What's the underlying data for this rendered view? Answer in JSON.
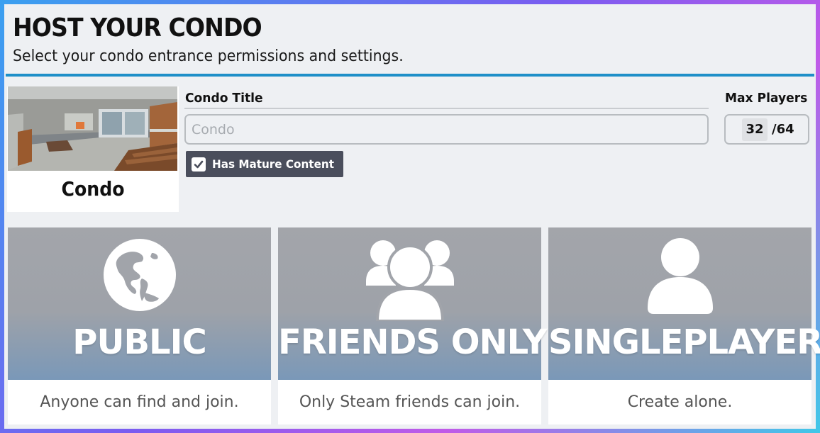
{
  "header": {
    "title": "HOST YOUR CONDO",
    "subtitle": "Select your condo entrance permissions and settings."
  },
  "condo": {
    "name": "Condo"
  },
  "form": {
    "title_label": "Condo Title",
    "title_placeholder": "Condo",
    "title_value": "",
    "mature_label": "Has Mature Content",
    "mature_checked": true,
    "max_players_label": "Max Players",
    "max_players_value": "32",
    "max_players_total": "/64"
  },
  "modes": [
    {
      "title": "PUBLIC",
      "description": "Anyone can find and join.",
      "icon": "globe-icon"
    },
    {
      "title": "FRIENDS ONLY",
      "description": "Only Steam friends can join.",
      "icon": "friends-icon"
    },
    {
      "title": "SINGLEPLAYER",
      "description": "Create alone.",
      "icon": "user-icon"
    }
  ],
  "colors": {
    "accent": "#1e8fc8",
    "card_gradient_top": "#a3a5aa",
    "card_gradient_bottom": "#7a98b8",
    "mature_bg": "#4a4e5c"
  }
}
